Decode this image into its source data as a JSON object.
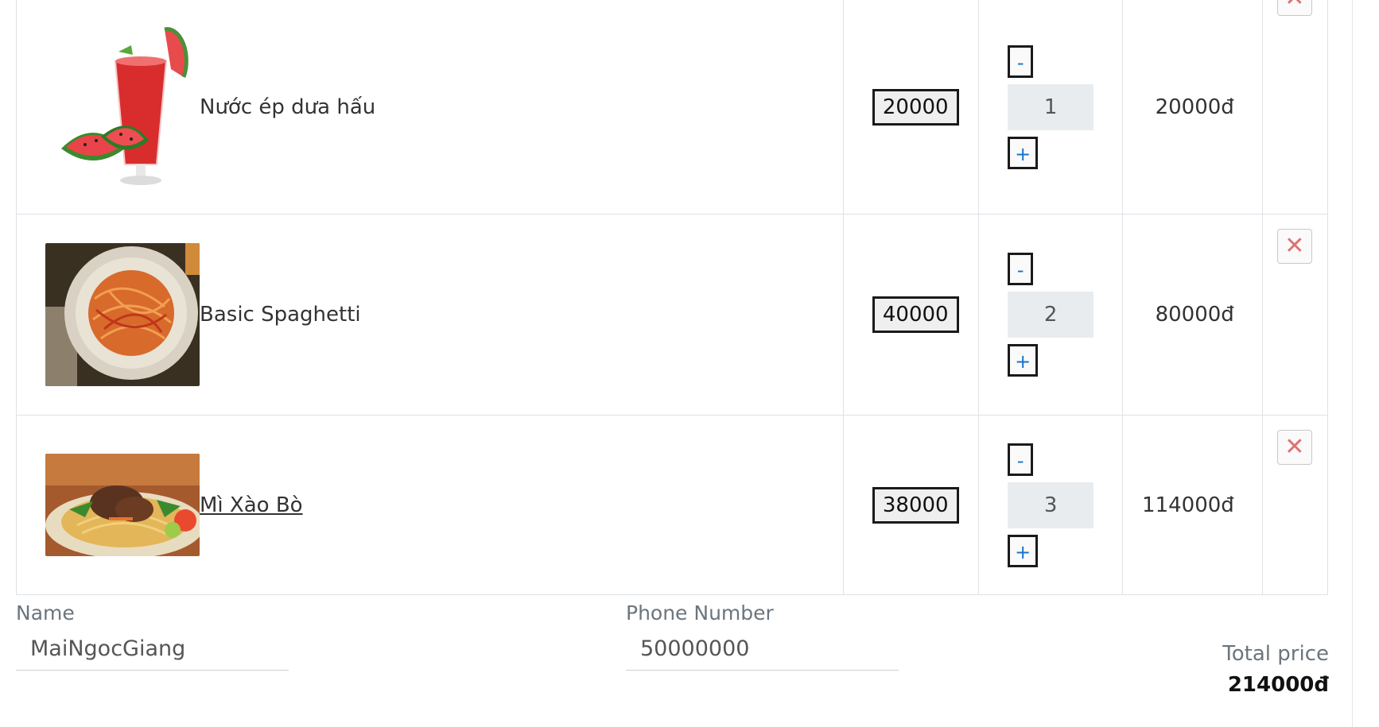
{
  "cart": {
    "items": [
      {
        "name": "Nước ép dưa hấu",
        "price": "20000",
        "qty_minus": "-",
        "quantity": "1",
        "qty_plus": "+",
        "subtotal": "20000đ",
        "delete": "✕"
      },
      {
        "name": "Basic Spaghetti",
        "price": "40000",
        "qty_minus": "-",
        "quantity": "2",
        "qty_plus": "+",
        "subtotal": "80000đ",
        "delete": "✕"
      },
      {
        "name": "Mì Xào Bò",
        "price": "38000",
        "qty_minus": "-",
        "quantity": "3",
        "qty_plus": "+",
        "subtotal": "114000đ",
        "delete": "✕"
      }
    ]
  },
  "form": {
    "name_label": "Name",
    "name_value": "MaiNgocGiang",
    "phone_label": "Phone Number",
    "phone_value": "50000000"
  },
  "summary": {
    "total_label": "Total price",
    "total_value": "214000đ"
  }
}
